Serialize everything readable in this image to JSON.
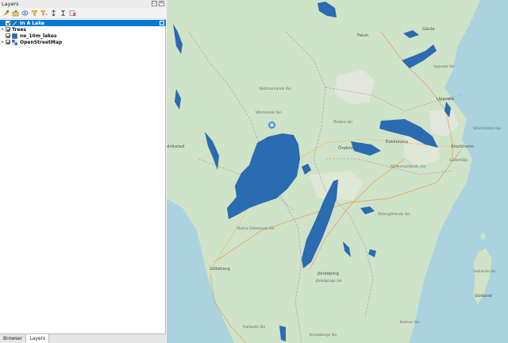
{
  "panel": {
    "title": "Layers",
    "title_buttons": [
      "☐",
      "✕"
    ],
    "toolbar_icons": [
      "open-layer-styling-icon",
      "add-group-icon",
      "manage-map-themes-icon",
      "filter-legend-icon",
      "filter-by-expression-icon",
      "expand-all-icon",
      "collapse-all-icon",
      "remove-layer-icon"
    ]
  },
  "layers": [
    {
      "label": "In A Lake",
      "checked": true,
      "selected": true,
      "icon": "line-layer-icon"
    },
    {
      "label": "Trees",
      "checked": true,
      "selected": false,
      "icon": "none"
    },
    {
      "label": "ne_10m_lakes",
      "checked": true,
      "selected": false,
      "icon": "polygon-layer-icon"
    },
    {
      "label": "OpenStreetMap",
      "checked": true,
      "selected": false,
      "icon": "raster-layer-icon"
    }
  ],
  "bottom_tabs": [
    "Browser",
    "Layers"
  ],
  "map": {
    "places": [
      "Falun",
      "Gävle",
      "Uppsala län",
      "Uppsala",
      "Västmanlands län",
      "Värmlands län",
      "Örebro län",
      "Örebro",
      "Eskilstuna",
      "Stockholm",
      "Stockholms län",
      "Södertälje",
      "Södermanlands län",
      "Östergötlands län",
      "Västra Götalands län",
      "Göteborg",
      "Jönköping",
      "Jönköpings län",
      "Gotlands län",
      "Gotland",
      "Hallands län",
      "drikstad",
      "Kronobergs län",
      "Kalmar län"
    ]
  },
  "colors": {
    "selection": "#0078d7",
    "lake_fill": "#2a6bb1",
    "sea": "#aad3df",
    "land": "#cfe3c8"
  }
}
